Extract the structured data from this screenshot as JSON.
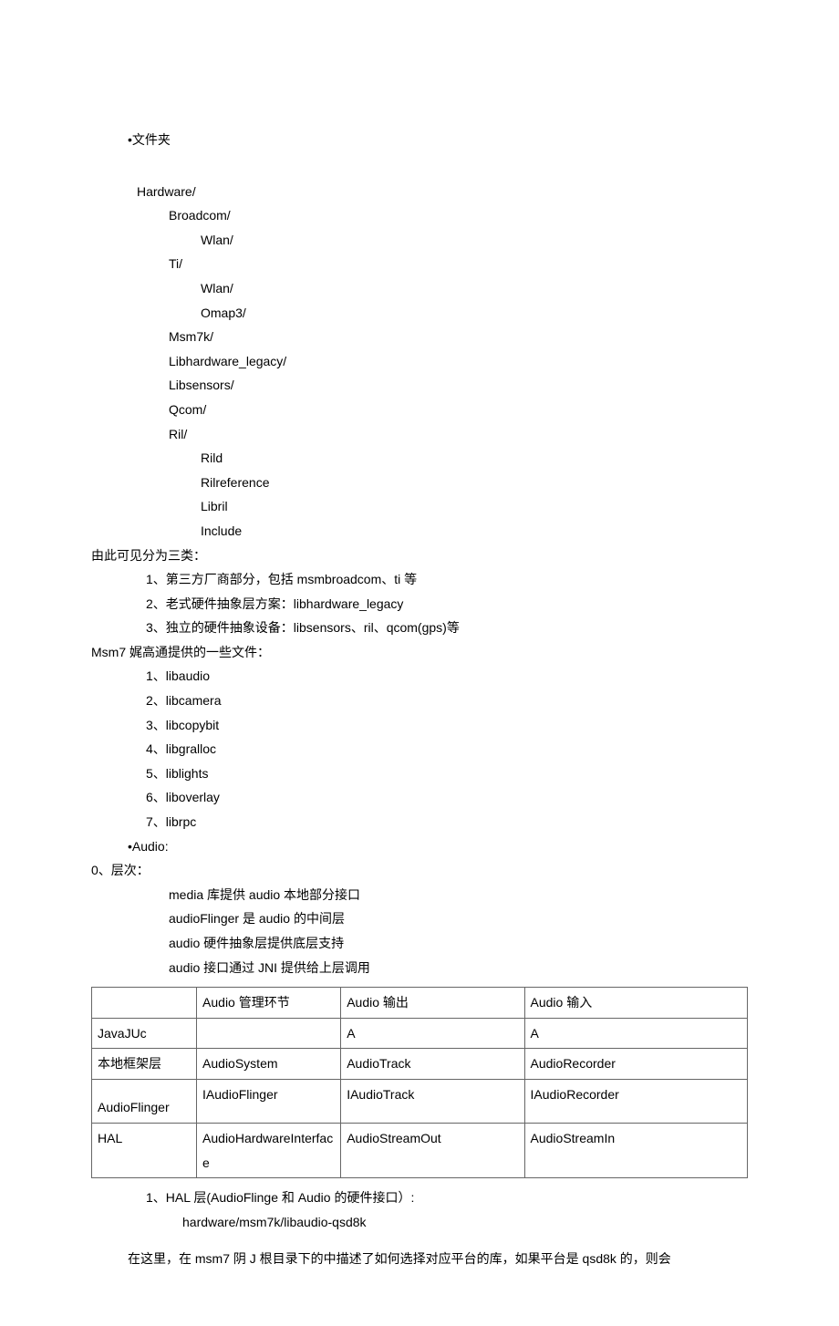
{
  "header": {
    "title": "•文件夹"
  },
  "tree": {
    "root": "Hardware/",
    "broadcom": "Broadcom/",
    "broadcom_wlan": "Wlan/",
    "ti": "Ti/",
    "ti_wlan": "Wlan/",
    "ti_omap3": "Omap3/",
    "msm7k": "Msm7k/",
    "libhardware_legacy": "Libhardware_legacy/",
    "libsensors": "Libsensors/",
    "qcom": "Qcom/",
    "ril": "Ril/",
    "rild": "Rild",
    "rilreference": "Rilreference",
    "libril": "Libril",
    "include": "Include"
  },
  "classify": {
    "intro": "由此可见分为三类：",
    "item1": "1、第三方厂商部分，包括 msmbroadcom、ti 等",
    "item2": "2、老式硬件抽象层方案：libhardware_legacy",
    "item3": "3、独立的硬件抽象设备：libsensors、ril、qcom(gps)等"
  },
  "msm7": {
    "intro": "Msm7 娓高通提供的一些文件：",
    "i1": "1、libaudio",
    "i2": "2、libcamera",
    "i3": "3、libcopybit",
    "i4": "4、libgralloc",
    "i5": "5、liblights",
    "i6": "6、liboverlay",
    "i7": "7、librpc"
  },
  "audio": {
    "header": "•Audio:",
    "layer_intro": "0、层次：",
    "l1": "media 库提供 audio 本地部分接口",
    "l2": "audioFlinger 是 audio 的中间层",
    "l3": "audio 硬件抽象层提供底层支持",
    "l4": "audio 接口通过 JNI 提供给上层调用"
  },
  "table": {
    "h2": "Audio 管理环节",
    "h3": "Audio 输出",
    "h4": "Audio 输入",
    "r1c1": "JavaJUc",
    "r1c2": "",
    "r1c3": "A",
    "r1c4": "A",
    "r2c1": "本地框架层",
    "r2c2": "AudioSystem",
    "r2c3": "AudioTrack",
    "r2c4": "AudioRecorder",
    "r3c1": " AudioFlinger",
    "r3c2": "IAudioFlinger",
    "r3c3": "IAudioTrack",
    "r3c4": "IAudioRecorder",
    "r4c1": "HAL",
    "r4c2": "AudioHardwareInterface",
    "r4c3": "AudioStreamOut",
    "r4c4": "AudioStreamIn"
  },
  "hal": {
    "line1": "1、HAL 层(AudioFlinge 和 Audio 的硬件接口）:",
    "line2": "hardware/msm7k/libaudio-qsd8k"
  },
  "closing": {
    "text": "在这里，在 msm7 阴 J 根目录下的中描述了如何选择对应平台的库，如果平台是 qsd8k 的，则会"
  }
}
